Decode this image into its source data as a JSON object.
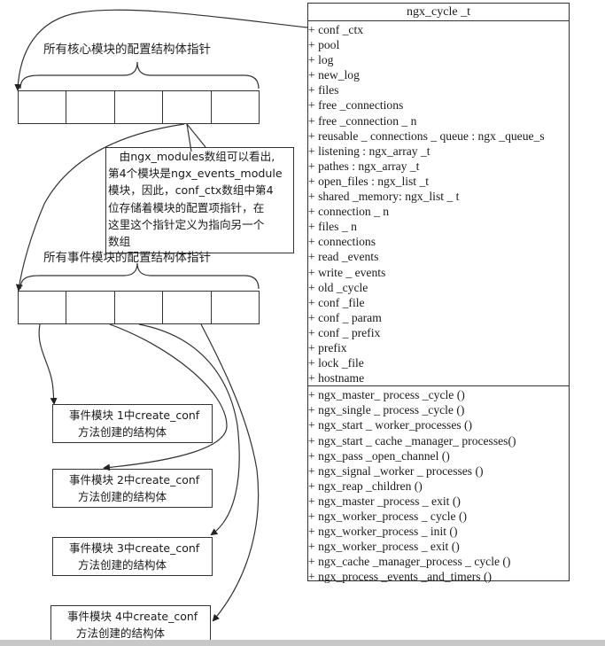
{
  "uml": {
    "title": "ngx_cycle _t",
    "attributes": [
      "+ conf _ctx",
      "+ pool",
      "+ log",
      "+ new_log",
      "+ files",
      "+ free _connections",
      "+ free _connection _ n",
      "+ reusable _ connections _ queue : ngx _queue_s",
      "+ listening : ngx_array _t",
      "+ pathes : ngx_array _t",
      "+ open_files : ngx_list _t",
      "+ shared _memory: ngx_list _ t",
      "+ connection _ n",
      "+ files _ n",
      "+ connections",
      "+ read _events",
      "+ write _ events",
      "+ old _cycle",
      "+ conf _file",
      "+ conf _ param",
      "+ conf _ prefix",
      "+ prefix",
      "+ lock _file",
      "+ hostname"
    ],
    "methods": [
      "+ ngx_master_ process _cycle ()",
      "+ ngx_single _ process _cycle ()",
      "+ ngx_start _ worker_processes ()",
      "+ ngx_start _ cache _manager_ processes()",
      "+ ngx_pass _open_channel ()",
      "+ ngx_signal _worker _ processes ()",
      "+ ngx_reap _children ()",
      "+ ngx_master _process _ exit ()",
      "+ ngx_worker_process _ cycle ()",
      "+ ngx_worker_process _ init ()",
      "+ ngx_worker_process _ exit ()",
      "+ ngx_cache _manager_process _ cycle ()",
      "+ ngx_process _events _and_timers ()"
    ]
  },
  "core_array": {
    "label": "所有核心模块的配置结构体指针",
    "cell_count": 5
  },
  "note": {
    "lines": [
      "　由ngx_modules数组可以看出,",
      "第4个模块是ngx_events_module",
      "模块，因此，conf_ctx数组中第4",
      "位存储着模块的配置项指针，在",
      "这里这个指针定义为指向另一个",
      "数组"
    ]
  },
  "event_array": {
    "label": "所有事件模块的配置结构体指针",
    "cell_count": 5
  },
  "event_boxes": [
    {
      "line1": "事件模块 1中create_conf",
      "line2": "方法创建的结构体"
    },
    {
      "line1": "事件模块 2中create_conf",
      "line2": "方法创建的结构体"
    },
    {
      "line1": "事件模块 3中create_conf",
      "line2": "方法创建的结构体"
    },
    {
      "line1": "事件模块 4中create_conf",
      "line2": "方法创建的结构体"
    }
  ]
}
